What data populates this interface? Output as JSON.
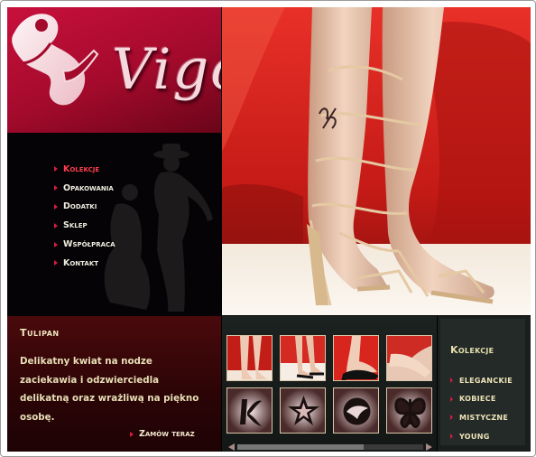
{
  "brand": {
    "logo_text": "Vigo",
    "logo_icon": "woman-silhouette-logo"
  },
  "nav": {
    "items": [
      {
        "label": "Kolekcje",
        "active": true
      },
      {
        "label": "Opakowania",
        "active": false
      },
      {
        "label": "Dodatki",
        "active": false
      },
      {
        "label": "Sklep",
        "active": false
      },
      {
        "label": "Współpraca",
        "active": false
      },
      {
        "label": "Kontakt",
        "active": false
      }
    ]
  },
  "promo": {
    "title": "Tulipan",
    "text": "Delikatny kwiat na nodze zaciekawia i odzwierciedla delikatną oraz wrażliwą na piękno osobę.",
    "order_label": "Zamów teraz"
  },
  "gallery": {
    "photos": [
      "legs-red-sofa-photo",
      "feet-black-sandals-photo",
      "foot-black-heel-photo",
      "legs-reclining-photo"
    ],
    "icons": [
      "tribal-k-tattoo-icon",
      "star-tattoo-icon",
      "bird-tattoo-icon",
      "butterfly-tattoo-icon"
    ],
    "scroll_position": 0.0,
    "scroll_visible_fraction": 0.68
  },
  "collections": {
    "title": "Kolekcje",
    "items": [
      "ELEGANCKIE",
      "KOBIECE",
      "MISTYCZNE",
      "YOUNG"
    ]
  },
  "colors": {
    "brand_red": "#c8103c",
    "accent_arrow": "#d21e3c",
    "active_nav": "#ff3f4f",
    "text_cream": "#efe6bf"
  }
}
